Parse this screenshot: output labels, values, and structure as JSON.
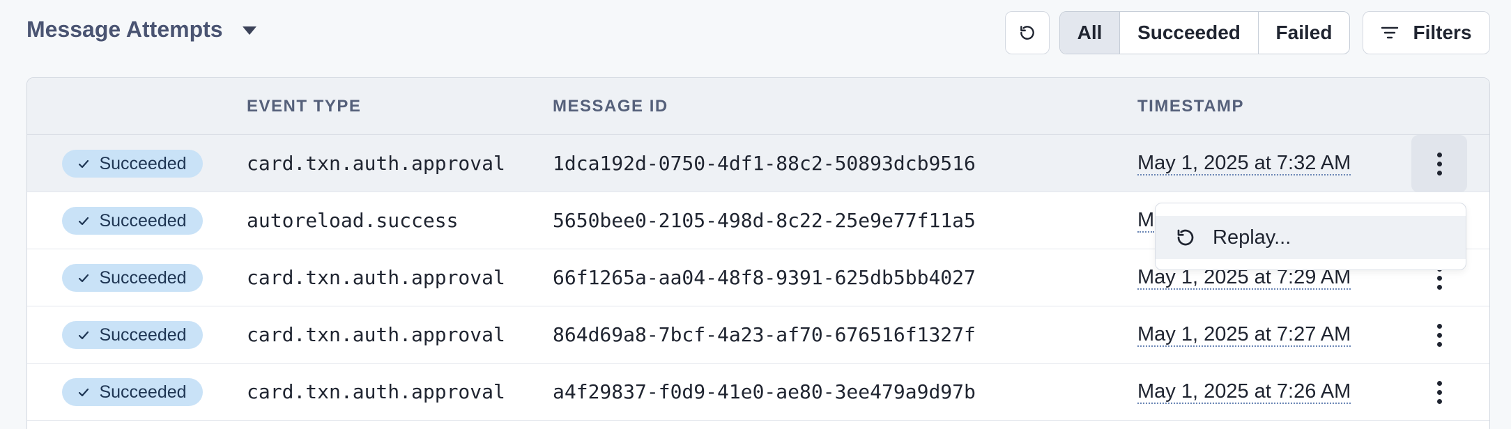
{
  "header": {
    "title": "Message Attempts",
    "filter_segments": [
      "All",
      "Succeeded",
      "Failed"
    ],
    "selected_segment": "All",
    "filters_label": "Filters"
  },
  "table": {
    "columns": [
      "",
      "EVENT TYPE",
      "MESSAGE ID",
      "TIMESTAMP"
    ],
    "rows": [
      {
        "status": "Succeeded",
        "event_type": "card.txn.auth.approval",
        "message_id": "1dca192d-0750-4df1-88c2-50893dcb9516",
        "timestamp": "May 1, 2025 at 7:32 AM"
      },
      {
        "status": "Succeeded",
        "event_type": "autoreload.success",
        "message_id": "5650bee0-2105-498d-8c22-25e9e77f11a5",
        "timestamp": "M"
      },
      {
        "status": "Succeeded",
        "event_type": "card.txn.auth.approval",
        "message_id": "66f1265a-aa04-48f8-9391-625db5bb4027",
        "timestamp": "May 1, 2025 at 7:29 AM"
      },
      {
        "status": "Succeeded",
        "event_type": "card.txn.auth.approval",
        "message_id": "864d69a8-7bcf-4a23-af70-676516f1327f",
        "timestamp": "May 1, 2025 at 7:27 AM"
      },
      {
        "status": "Succeeded",
        "event_type": "card.txn.auth.approval",
        "message_id": "a4f29837-f0d9-41e0-ae80-3ee479a9d97b",
        "timestamp": "May 1, 2025 at 7:26 AM"
      }
    ]
  },
  "menu": {
    "items": [
      {
        "label": "Replay...",
        "icon": "replay-icon"
      }
    ]
  },
  "colors": {
    "accent_badge": "#c9e2f7",
    "title": "#4a5472",
    "timestamp_underline": "#6b86b5"
  }
}
